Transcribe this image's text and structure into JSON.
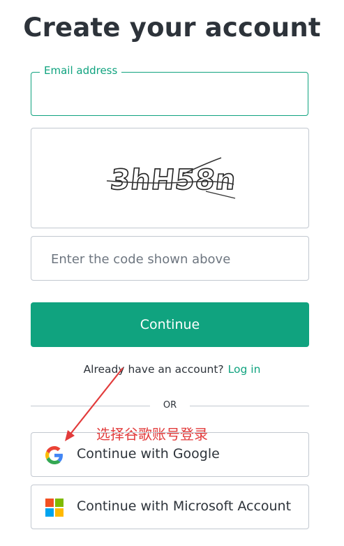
{
  "page": {
    "title": "Create your account"
  },
  "email": {
    "label": "Email address",
    "value": ""
  },
  "captcha": {
    "text": "3hH58n"
  },
  "code": {
    "placeholder": "Enter the code shown above",
    "value": ""
  },
  "actions": {
    "continue_label": "Continue"
  },
  "login": {
    "prompt": "Already have an account?",
    "link_label": "Log in"
  },
  "divider": {
    "label": "OR"
  },
  "annotation": {
    "text": "选择谷歌账号登录",
    "color": "#e23b3b"
  },
  "social": {
    "google_label": "Continue with Google",
    "microsoft_label": "Continue with Microsoft Account"
  },
  "colors": {
    "accent": "#10a37f",
    "border": "#c2c8d0",
    "text": "#2d333a"
  }
}
